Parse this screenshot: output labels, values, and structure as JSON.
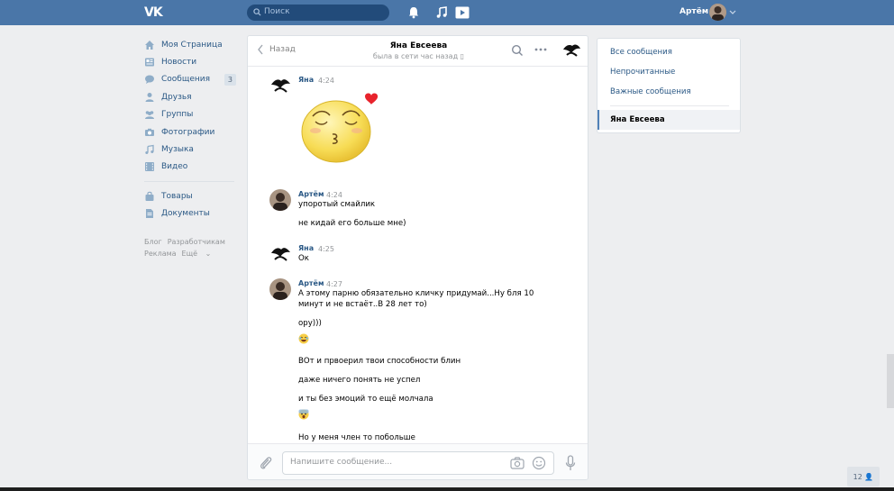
{
  "topbar": {
    "logo": "VK",
    "search_placeholder": "Поиск",
    "user_name": "Артём"
  },
  "leftnav": {
    "items": [
      {
        "label": "Моя Страница",
        "icon": "home-icon"
      },
      {
        "label": "Новости",
        "icon": "news-icon"
      },
      {
        "label": "Сообщения",
        "icon": "messages-icon",
        "count": "3"
      },
      {
        "label": "Друзья",
        "icon": "friends-icon"
      },
      {
        "label": "Группы",
        "icon": "groups-icon"
      },
      {
        "label": "Фотографии",
        "icon": "camera-icon"
      },
      {
        "label": "Музыка",
        "icon": "music-icon"
      },
      {
        "label": "Видео",
        "icon": "video-icon"
      }
    ],
    "items2": [
      {
        "label": "Товары",
        "icon": "bag-icon"
      },
      {
        "label": "Документы",
        "icon": "document-icon"
      }
    ],
    "footer": [
      "Блог",
      "Разработчикам",
      "Реклама",
      "Ещё"
    ]
  },
  "chat": {
    "back_label": "Назад",
    "title": "Яна Евсеева",
    "status": "была в сети час назад",
    "messages": [
      {
        "author": "Яна",
        "time": "4:24",
        "sticker": "kiss-sticker"
      },
      {
        "author": "Артём",
        "time": "4:24",
        "lines": [
          "упоротый смайлик",
          "не кидай его больше мне)"
        ]
      },
      {
        "author": "Яна",
        "time": "4:25",
        "lines": [
          "Ок"
        ]
      },
      {
        "author": "Артём",
        "time": "4:27",
        "lines": [
          "А этому парню обязательно кличку придумай...Ну бля 10",
          "минут и не встаёт..В 28 лет то)",
          "ору)))",
          "ВОт и првоерил твои способности блин",
          "даже ничего понять не успел",
          "и ты без эмоций то ещё молчала",
          "Но у меня член то побольше"
        ]
      }
    ],
    "composer_placeholder": "Напишите сообщение..."
  },
  "rightpanel": {
    "items": [
      "Все сообщения",
      "Непрочитанные",
      "Важные сообщения"
    ],
    "active": "Яна Евсеева"
  },
  "bottom_badge": "12",
  "colors": {
    "brand": "#4a76a8",
    "link": "#2a5885",
    "background": "#edeef0"
  }
}
